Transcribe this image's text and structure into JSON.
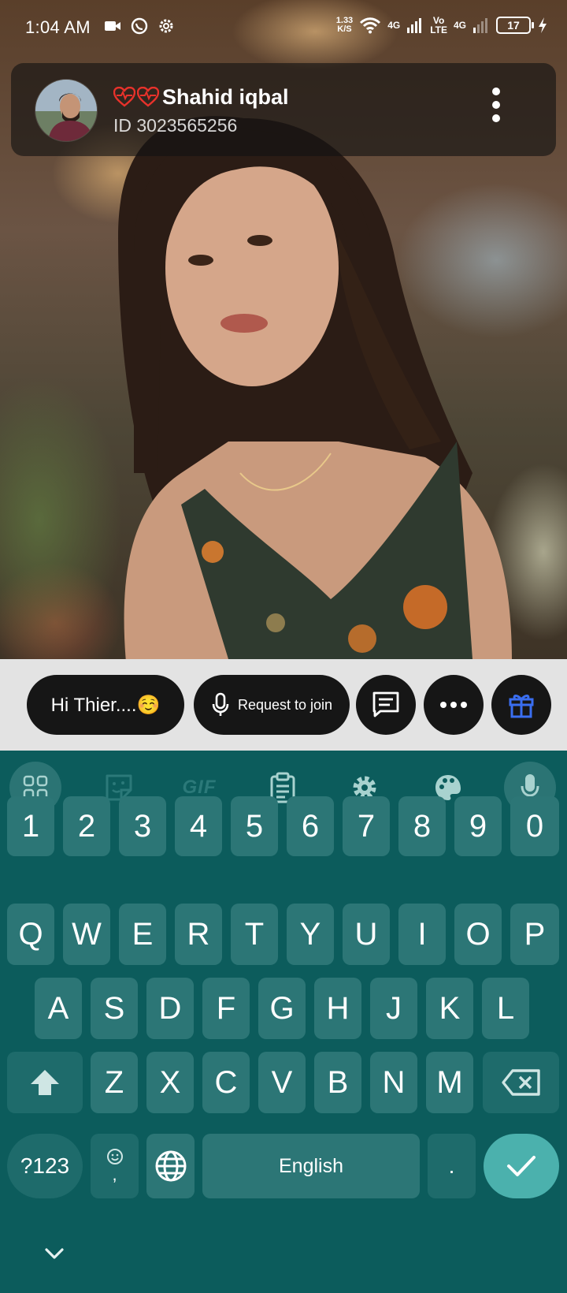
{
  "status_bar": {
    "time": "1:04 AM",
    "net_speed_value": "1.33",
    "net_speed_unit": "K/S",
    "sig1_label": "4G",
    "volte_top": "Vo",
    "volte_bottom": "LTE",
    "sig2_label": "4G",
    "battery": "17"
  },
  "profile": {
    "name": "Shahid iqbal",
    "id_text": "ID 3023565256"
  },
  "actions": {
    "greeting": "Hi Thier....☺️",
    "request_join": "Request to join"
  },
  "keyboard": {
    "toolbar": {
      "gif_label": "GIF"
    },
    "number_row": [
      "1",
      "2",
      "3",
      "4",
      "5",
      "6",
      "7",
      "8",
      "9",
      "0"
    ],
    "row1": [
      "Q",
      "W",
      "E",
      "R",
      "T",
      "Y",
      "U",
      "I",
      "O",
      "P"
    ],
    "row2": [
      "A",
      "S",
      "D",
      "F",
      "G",
      "H",
      "J",
      "K",
      "L"
    ],
    "row3": [
      "Z",
      "X",
      "C",
      "V",
      "B",
      "N",
      "M"
    ],
    "symbols_label": "?123",
    "emoji_comma": ",",
    "space_label": "English",
    "period_label": "."
  },
  "colors": {
    "keyboard_bg": "#0c5c5c",
    "key_bg": "#2c7676",
    "enter_bg": "#4bb1ad",
    "heart_red": "#e8322b",
    "gift_blue": "#3a6ef0"
  }
}
